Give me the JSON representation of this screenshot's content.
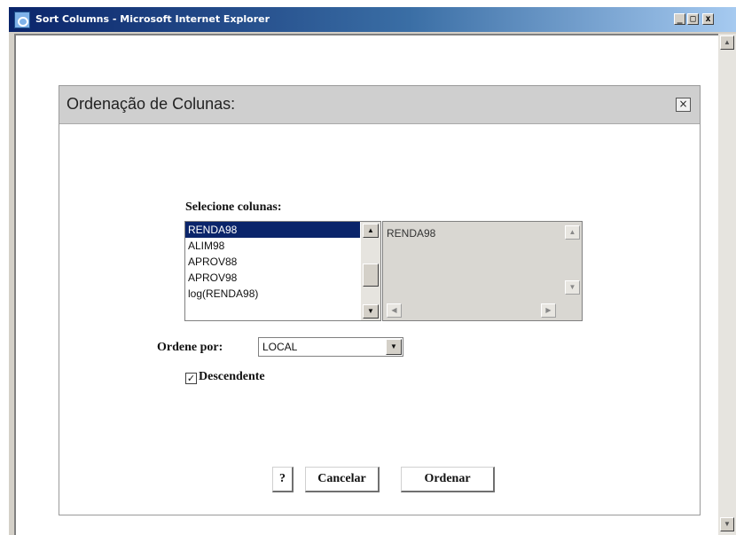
{
  "window": {
    "title": "Sort Columns - Microsoft Internet Explorer",
    "controls": {
      "minimize": "_",
      "maximize": "□",
      "close": "x"
    }
  },
  "dialog": {
    "title": "Ordenação de Colunas:",
    "close_symbol": "×",
    "select_columns_label": "Selecione colunas:",
    "columns_list": [
      {
        "label": "RENDA98",
        "selected": true
      },
      {
        "label": "ALIM98",
        "selected": false
      },
      {
        "label": "APROV88",
        "selected": false
      },
      {
        "label": "APROV98",
        "selected": false
      },
      {
        "label": "log(RENDA98)",
        "selected": false
      }
    ],
    "selected_columns_text": "RENDA98",
    "sort_by_label": "Ordene por:",
    "sort_by_value": "LOCAL",
    "descending_label": "Descendente",
    "descending_checked": true,
    "buttons": {
      "help": "?",
      "cancel": "Cancelar",
      "sort": "Ordenar"
    }
  },
  "icons": {
    "arrow_up": "▲",
    "arrow_down": "▼",
    "arrow_left": "◀",
    "arrow_right": "▶",
    "check": "✓",
    "dropdown": "▼"
  }
}
